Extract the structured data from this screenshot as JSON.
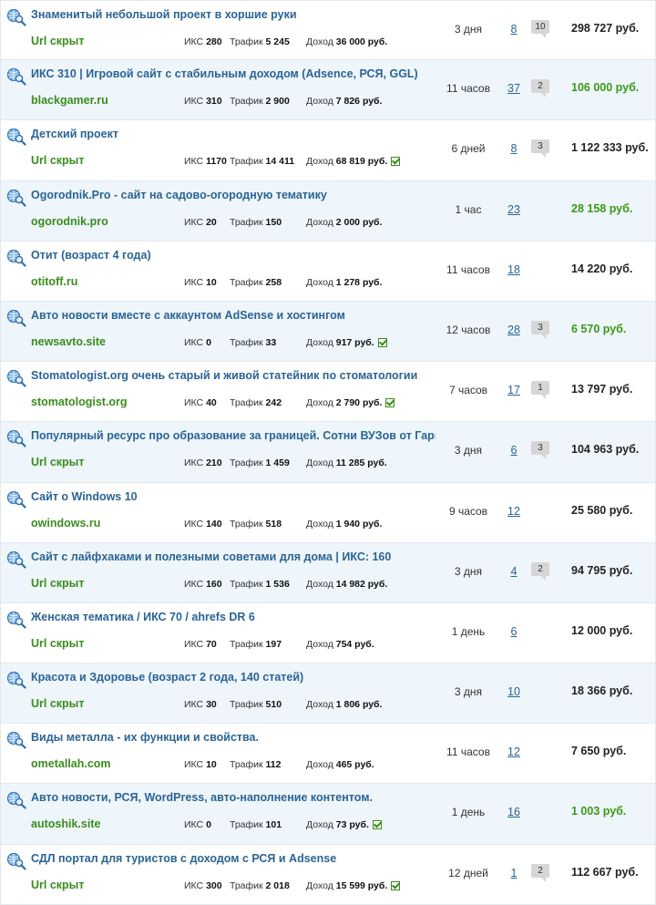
{
  "accent_colors": {
    "title": "#2a6496",
    "domain": "#3a8d1c",
    "price_highlight": "#3a9a16"
  },
  "labels": {
    "iks": "ИКС",
    "traffic": "Трафик",
    "income": "Доход"
  },
  "icon_name": "globe-search-icon",
  "listings": [
    {
      "title": "Знаменитый небольшой проект в хоршие руки",
      "domain": "Url скрыт",
      "iks": "280",
      "traffic": "5 245",
      "income": "36 000 руб.",
      "verified": false,
      "age": "3 дня",
      "bids": "8",
      "comments": "10",
      "price": "298 727 руб.",
      "price_green": false
    },
    {
      "title": "ИКС 310 | Игровой сайт с стабильным доходом (Adsence, РСЯ, GGL)",
      "domain": "blackgamer.ru",
      "iks": "310",
      "traffic": "2 900",
      "income": "7 826 руб.",
      "verified": false,
      "age": "11 часов",
      "bids": "37",
      "comments": "2",
      "price": "106 000 руб.",
      "price_green": true
    },
    {
      "title": "Детский проект",
      "domain": "Url скрыт",
      "iks": "1170",
      "traffic": "14 411",
      "income": "68 819 руб.",
      "verified": true,
      "age": "6 дней",
      "bids": "8",
      "comments": "3",
      "price": "1 122 333 руб.",
      "price_green": false
    },
    {
      "title": "Ogorodnik.Pro - сайт на садово-огородную тематику",
      "domain": "ogorodnik.pro",
      "iks": "20",
      "traffic": "150",
      "income": "2 000 руб.",
      "verified": false,
      "age": "1 час",
      "bids": "23",
      "comments": "",
      "price": "28 158 руб.",
      "price_green": true
    },
    {
      "title": "Отит (возраст 4 года)",
      "domain": "otitoff.ru",
      "iks": "10",
      "traffic": "258",
      "income": "1 278 руб.",
      "verified": false,
      "age": "11 часов",
      "bids": "18",
      "comments": "",
      "price": "14 220 руб.",
      "price_green": false
    },
    {
      "title": "Авто новости вместе с аккаунтом AdSense и хостингом",
      "domain": "newsavto.site",
      "iks": "0",
      "traffic": "33",
      "income": "917 руб.",
      "verified": true,
      "age": "12 часов",
      "bids": "28",
      "comments": "3",
      "price": "6 570 руб.",
      "price_green": true
    },
    {
      "title": "Stomatologist.org очень старый и живой статейник по стоматологии",
      "domain": "stomatologist.org",
      "iks": "40",
      "traffic": "242",
      "income": "2 790 руб.",
      "verified": true,
      "age": "7 часов",
      "bids": "17",
      "comments": "1",
      "price": "13 797 руб.",
      "price_green": false
    },
    {
      "title": "Популярный ресурс про образование за границей. Сотни ВУЗов от Гарвара",
      "domain": "Url скрыт",
      "iks": "210",
      "traffic": "1 459",
      "income": "11 285 руб.",
      "verified": false,
      "age": "3 дня",
      "bids": "6",
      "comments": "3",
      "price": "104 963 руб.",
      "price_green": false
    },
    {
      "title": "Сайт о Windows 10",
      "domain": "owindows.ru",
      "iks": "140",
      "traffic": "518",
      "income": "1 940 руб.",
      "verified": false,
      "age": "9 часов",
      "bids": "12",
      "comments": "",
      "price": "25 580 руб.",
      "price_green": false
    },
    {
      "title": "Сайт с лайфхаками и полезными советами для дома | ИКС: 160",
      "domain": "Url скрыт",
      "iks": "160",
      "traffic": "1 536",
      "income": "14 982 руб.",
      "verified": false,
      "age": "3 дня",
      "bids": "4",
      "comments": "2",
      "price": "94 795 руб.",
      "price_green": false
    },
    {
      "title": "Женская тематика / ИКС 70 / ahrefs DR 6",
      "domain": "Url скрыт",
      "iks": "70",
      "traffic": "197",
      "income": "754 руб.",
      "verified": false,
      "age": "1 день",
      "bids": "6",
      "comments": "",
      "price": "12 000 руб.",
      "price_green": false
    },
    {
      "title": "Красота и Здоровье (возраст 2 года, 140 статей)",
      "domain": "Url скрыт",
      "iks": "30",
      "traffic": "510",
      "income": "1 806 руб.",
      "verified": false,
      "age": "3 дня",
      "bids": "10",
      "comments": "",
      "price": "18 366 руб.",
      "price_green": false
    },
    {
      "title": "Виды металла - их функции и свойства.",
      "domain": "ometallah.com",
      "iks": "10",
      "traffic": "112",
      "income": "465 руб.",
      "verified": false,
      "age": "11 часов",
      "bids": "12",
      "comments": "",
      "price": "7 650 руб.",
      "price_green": false
    },
    {
      "title": "Авто новости, РСЯ, WordPress, авто-наполнение контентом.",
      "domain": "autoshik.site",
      "iks": "0",
      "traffic": "101",
      "income": "73 руб.",
      "verified": true,
      "age": "1 день",
      "bids": "16",
      "comments": "",
      "price": "1 003 руб.",
      "price_green": true
    },
    {
      "title": "СДЛ портал для туристов с доходом с РСЯ и Adsense",
      "domain": "Url скрыт",
      "iks": "300",
      "traffic": "2 018",
      "income": "15 599 руб.",
      "verified": true,
      "age": "12 дней",
      "bids": "1",
      "comments": "2",
      "price": "112 667 руб.",
      "price_green": false
    }
  ]
}
